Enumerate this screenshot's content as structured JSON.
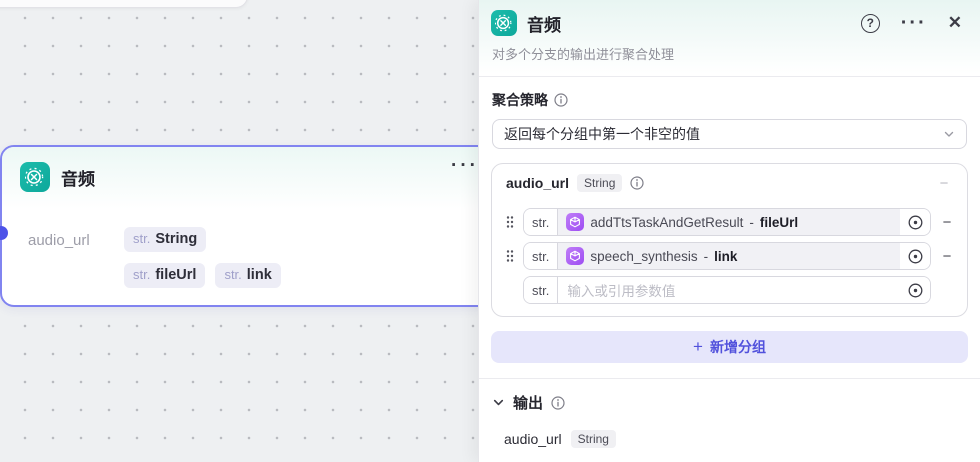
{
  "canvas": {
    "node": {
      "title": "音频",
      "more_glyph": "···",
      "output_param": {
        "name": "audio_url",
        "chips": [
          {
            "prefix": "str.",
            "label": "String"
          },
          {
            "prefix": "str.",
            "label": "fileUrl"
          },
          {
            "prefix": "str.",
            "label": "link"
          }
        ]
      }
    }
  },
  "panel": {
    "header": {
      "title": "音频",
      "help_glyph": "?",
      "more_glyph": "···",
      "close_glyph": "✕"
    },
    "description": "对多个分支的输出进行聚合处理",
    "strategy": {
      "label": "聚合策略",
      "selected_value": "返回每个分组中第一个非空的值"
    },
    "group": {
      "name": "audio_url",
      "type": "String",
      "remove_glyph": "−",
      "rows": [
        {
          "type_label": "str.",
          "ref_node": "addTtsTaskAndGetResult",
          "sep": "-",
          "ref_field": "fileUrl",
          "remove_glyph": "−"
        },
        {
          "type_label": "str.",
          "ref_node": "speech_synthesis",
          "sep": "-",
          "ref_field": "link",
          "remove_glyph": "−"
        },
        {
          "type_label": "str.",
          "placeholder": "输入或引用参数值"
        }
      ]
    },
    "add_group": {
      "plus_glyph": "+",
      "label": "新增分组"
    },
    "output": {
      "label": "输出",
      "params": [
        {
          "name": "audio_url",
          "type": "String"
        }
      ]
    }
  },
  "colors": {
    "accent_teal": "#14b3a6",
    "accent_purple": "#5151dc",
    "node_border": "#8184f0",
    "port_blue": "#4d53e8",
    "plugin_purple": "#a85cf4"
  }
}
